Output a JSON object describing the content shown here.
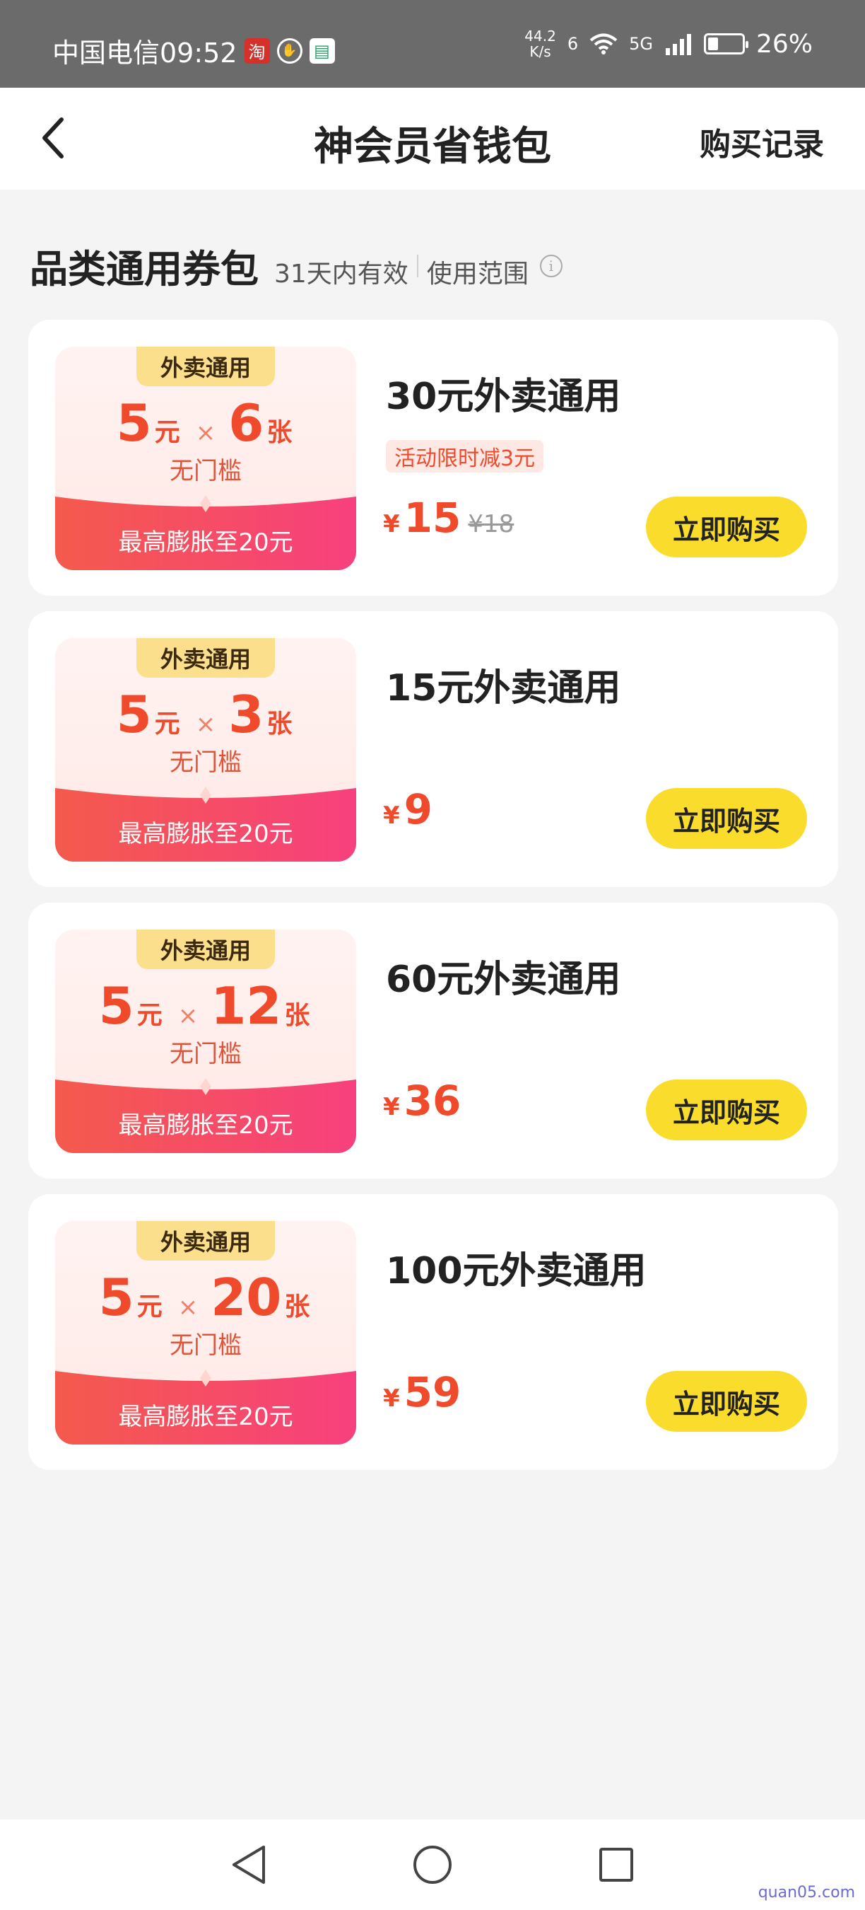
{
  "status_bar": {
    "carrier_time": "中国电信09:52",
    "taobao_icon_text": "淘",
    "net_speed_value": "44.2",
    "net_speed_unit": "K/s",
    "signal_label_a": "6",
    "signal_label_b": "5G",
    "battery_text": "26%",
    "battery_level": 0.26
  },
  "header": {
    "title": "神会员省钱包",
    "record_label": "购买记录"
  },
  "section": {
    "title": "品类通用券包",
    "validity": "31天内有效",
    "scope_label": "使用范围"
  },
  "packages": [
    {
      "tag": "外卖通用",
      "amount": "5",
      "amount_unit": "元",
      "times": "×",
      "count": "6",
      "count_unit": "张",
      "condition": "无门槛",
      "bottom_text": "最高膨胀至20元",
      "title": "30元外卖通用",
      "promo": "活动限时减3元",
      "currency": "¥",
      "price": "15",
      "original_price": "¥18",
      "button": "立即购买"
    },
    {
      "tag": "外卖通用",
      "amount": "5",
      "amount_unit": "元",
      "times": "×",
      "count": "3",
      "count_unit": "张",
      "condition": "无门槛",
      "bottom_text": "最高膨胀至20元",
      "title": "15元外卖通用",
      "currency": "¥",
      "price": "9",
      "button": "立即购买"
    },
    {
      "tag": "外卖通用",
      "amount": "5",
      "amount_unit": "元",
      "times": "×",
      "count": "12",
      "count_unit": "张",
      "condition": "无门槛",
      "bottom_text": "最高膨胀至20元",
      "title": "60元外卖通用",
      "currency": "¥",
      "price": "36",
      "button": "立即购买"
    },
    {
      "tag": "外卖通用",
      "amount": "5",
      "amount_unit": "元",
      "times": "×",
      "count": "20",
      "count_unit": "张",
      "condition": "无门槛",
      "bottom_text": "最高膨胀至20元",
      "title": "100元外卖通用",
      "currency": "¥",
      "price": "59",
      "button": "立即购买"
    }
  ],
  "system_nav": {
    "back_icon": "triangle-back-icon",
    "home_icon": "circle-home-icon",
    "recents_icon": "square-recents-icon"
  },
  "watermark": "quan05.com",
  "colors": {
    "accent_red": "#f04a2c",
    "button_yellow": "#fadd2c",
    "tag_yellow": "#fbdf8c",
    "status_bar_bg": "#6b6b6b"
  }
}
